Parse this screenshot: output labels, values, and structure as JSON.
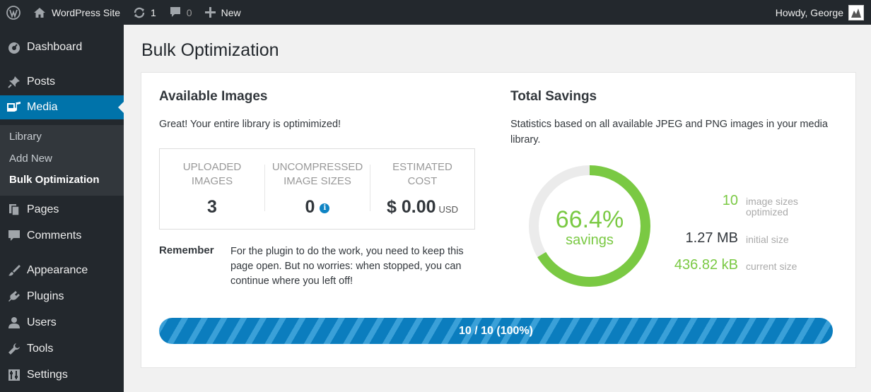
{
  "admin_bar": {
    "site_name": "WordPress Site",
    "updates_count": "1",
    "comments_count": "0",
    "new_label": "New",
    "greeting": "Howdy, George"
  },
  "sidebar": {
    "items": [
      {
        "label": "Dashboard",
        "icon": "dashboard-icon"
      },
      {
        "label": "Posts",
        "icon": "pin-icon"
      },
      {
        "label": "Media",
        "icon": "media-icon"
      },
      {
        "label": "Pages",
        "icon": "pages-icon"
      },
      {
        "label": "Comments",
        "icon": "comment-icon"
      },
      {
        "label": "Appearance",
        "icon": "brush-icon"
      },
      {
        "label": "Plugins",
        "icon": "plug-icon"
      },
      {
        "label": "Users",
        "icon": "user-icon"
      },
      {
        "label": "Tools",
        "icon": "wrench-icon"
      },
      {
        "label": "Settings",
        "icon": "sliders-icon"
      }
    ],
    "media_submenu": [
      "Library",
      "Add New",
      "Bulk Optimization"
    ]
  },
  "page": {
    "title": "Bulk Optimization"
  },
  "available": {
    "heading": "Available Images",
    "message": "Great! Your entire library is optimimized!",
    "stats": [
      {
        "label_line1": "UPLOADED",
        "label_line2": "IMAGES",
        "value": "3"
      },
      {
        "label_line1": "UNCOMPRESSED",
        "label_line2": "IMAGE SIZES",
        "value": "0"
      },
      {
        "label_line1": "ESTIMATED",
        "label_line2": "COST",
        "value": "$ 0.00",
        "unit": "USD"
      }
    ],
    "remember_label": "Remember",
    "remember_text": "For the plugin to do the work, you need to keep this page open. But no worries: when stopped, you can continue where you left off!"
  },
  "savings": {
    "heading": "Total Savings",
    "description": "Statistics based on all available JPEG and PNG images in your media library.",
    "percent_text": "66.4%",
    "percent_value": 66.4,
    "percent_label": "savings",
    "metrics": [
      {
        "value": "10",
        "label_line1": "image sizes",
        "label_line2": "optimized",
        "color": "#7ac943"
      },
      {
        "value": "1.27 MB",
        "label_line1": "initial size",
        "label_line2": "",
        "color": "#32373c"
      },
      {
        "value": "436.82 kB",
        "label_line1": "current size",
        "label_line2": "",
        "color": "#7ac943"
      }
    ]
  },
  "progress": {
    "text": "10 / 10 (100%)",
    "fraction": 1.0
  },
  "colors": {
    "accent_blue": "#0073aa",
    "green": "#7ac943",
    "admin_dark": "#23282d"
  }
}
